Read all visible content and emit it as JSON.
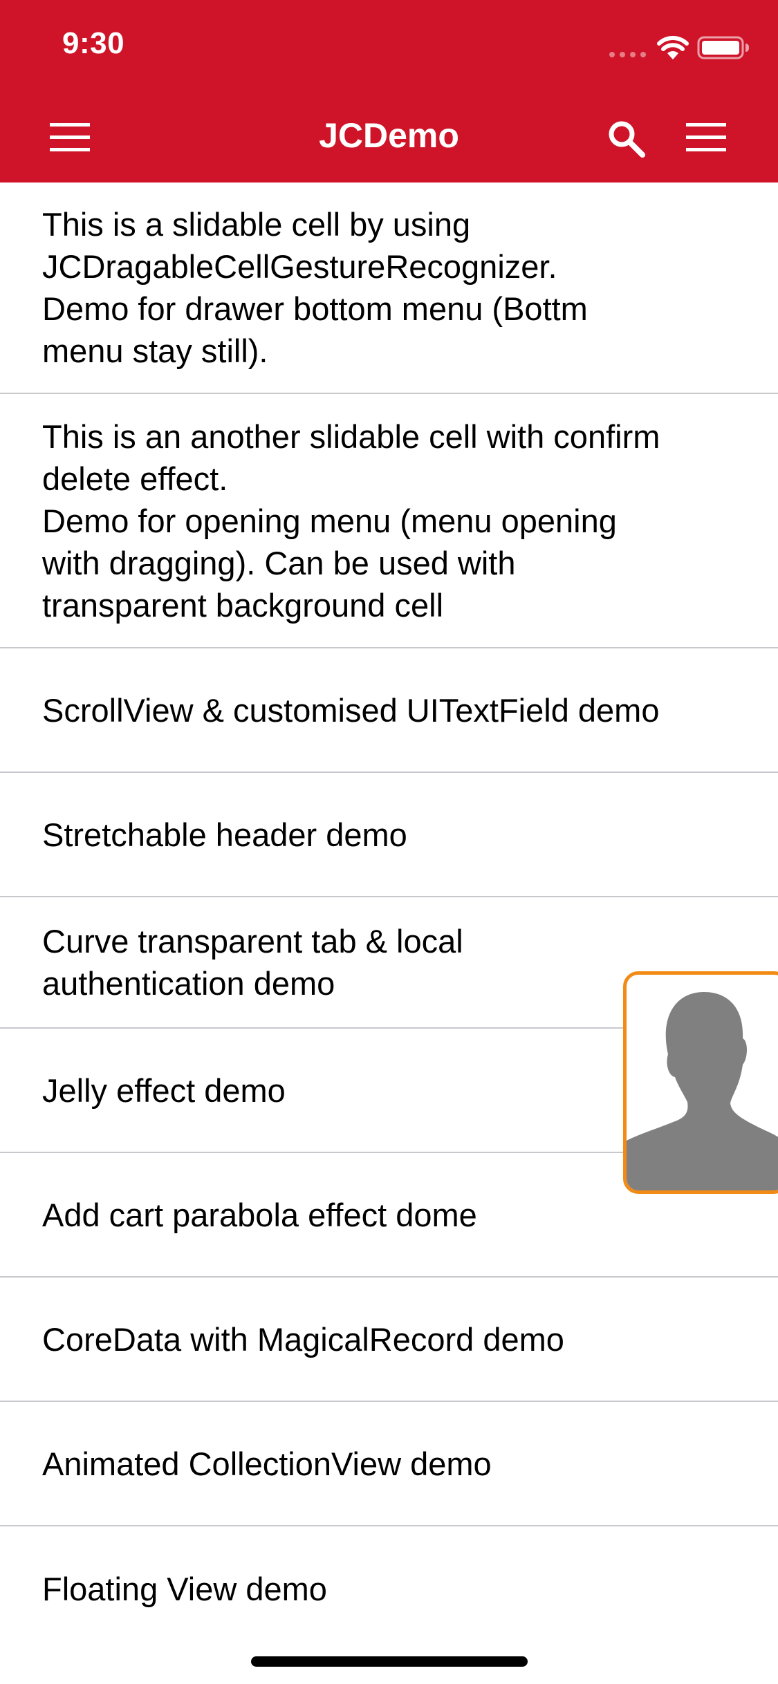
{
  "status_bar": {
    "time": "9:30"
  },
  "nav_bar": {
    "title": "JCDemo",
    "left_icon": "hamburger-menu-icon",
    "search_icon": "search-icon",
    "right_icon": "hamburger-menu-icon"
  },
  "colors": {
    "nav_background": "#cf1429",
    "floating_border": "#f28b16",
    "separator": "#c8c7cc"
  },
  "demo_list": {
    "items": [
      {
        "label": "This is a slidable cell by using\nJCDragableCellGestureRecognizer.\nDemo for drawer bottom menu (Bottm\nmenu stay still)."
      },
      {
        "label": "This is an another slidable cell with confirm\ndelete effect.\nDemo for opening menu (menu opening\nwith dragging). Can be used with\ntransparent background cell"
      },
      {
        "label": "ScrollView & customised UITextField demo"
      },
      {
        "label": "Stretchable header demo"
      },
      {
        "label": "Curve transparent tab & local\nauthentication demo"
      },
      {
        "label": "Jelly effect demo"
      },
      {
        "label": "Add cart parabola effect dome"
      },
      {
        "label": "CoreData with MagicalRecord demo"
      },
      {
        "label": "Animated CollectionView demo"
      },
      {
        "label": "Floating View demo"
      }
    ]
  },
  "floating_view": {
    "icon": "person-silhouette-icon"
  }
}
